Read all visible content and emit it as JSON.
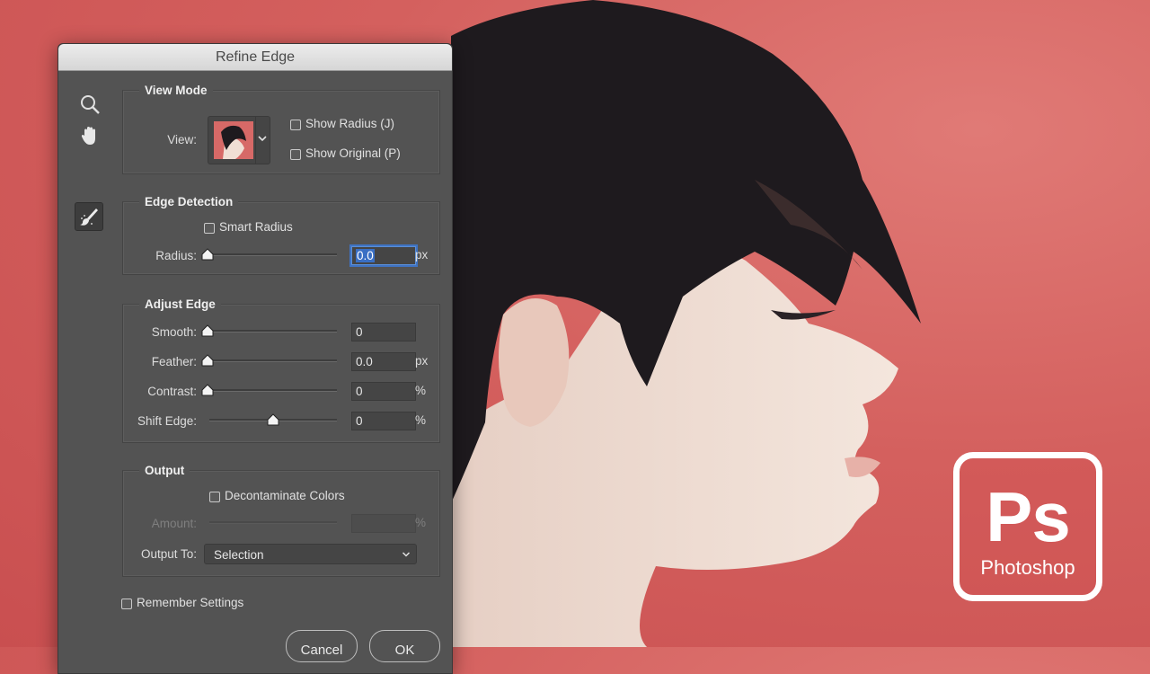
{
  "dialog": {
    "title": "Refine Edge",
    "tools": [
      "zoom-icon",
      "hand-icon",
      "refine-brush-icon"
    ],
    "view_mode": {
      "title": "View Mode",
      "view_label": "View:",
      "show_radius": {
        "label": "Show Radius (J)",
        "checked": false
      },
      "show_original": {
        "label": "Show Original (P)",
        "checked": false
      }
    },
    "edge_detection": {
      "title": "Edge Detection",
      "smart_radius": {
        "label": "Smart Radius",
        "checked": false
      },
      "radius": {
        "label": "Radius:",
        "value": "0.0",
        "unit": "px",
        "level": 0
      }
    },
    "adjust_edge": {
      "title": "Adjust Edge",
      "smooth": {
        "label": "Smooth:",
        "value": "0",
        "unit": "",
        "level": 0
      },
      "feather": {
        "label": "Feather:",
        "value": "0.0",
        "unit": "px",
        "level": 0
      },
      "contrast": {
        "label": "Contrast:",
        "value": "0",
        "unit": "%",
        "level": 0
      },
      "shift_edge": {
        "label": "Shift Edge:",
        "value": "0",
        "unit": "%",
        "level": 0.5
      }
    },
    "output": {
      "title": "Output",
      "decontaminate": {
        "label": "Decontaminate Colors",
        "checked": false
      },
      "amount": {
        "label": "Amount:",
        "value": "",
        "unit": "%"
      },
      "output_to_label": "Output To:",
      "output_to_value": "Selection"
    },
    "remember": {
      "label": "Remember Settings",
      "checked": false
    },
    "cancel_label": "Cancel",
    "ok_label": "OK"
  },
  "logo": {
    "mark": "Ps",
    "wordmark": "Photoshop"
  },
  "colors": {
    "background": "#d4605e",
    "panel": "#535353",
    "focus": "#3a6fc4"
  }
}
